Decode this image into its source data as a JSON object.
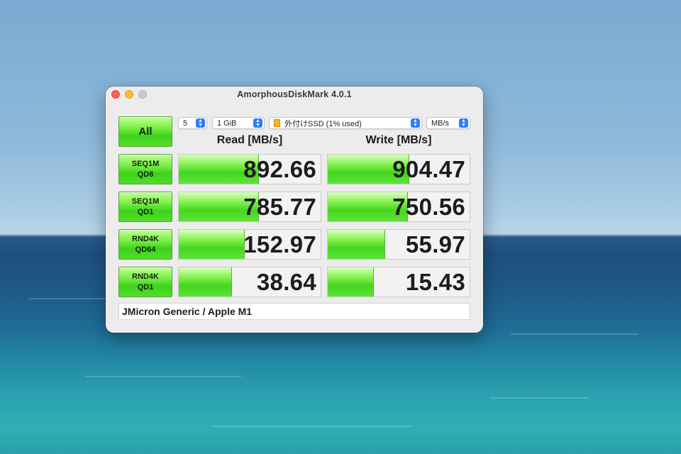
{
  "window": {
    "title": "AmorphousDiskMark 4.0.1"
  },
  "toolbar": {
    "all_label": "All",
    "count": "5",
    "size": "1 GiB",
    "drive": "外付けSSD (1% used)",
    "unit": "MB/s"
  },
  "headers": {
    "read": "Read [MB/s]",
    "write": "Write [MB/s]"
  },
  "tests": [
    {
      "line1": "SEQ1M",
      "line2": "QD8",
      "read": "892.66",
      "write": "904.47",
      "read_fill": 0.56,
      "write_fill": 0.57
    },
    {
      "line1": "SEQ1M",
      "line2": "QD1",
      "read": "785.77",
      "write": "750.56",
      "read_fill": 0.56,
      "write_fill": 0.56
    },
    {
      "line1": "RND4K",
      "line2": "QD64",
      "read": "152.97",
      "write": "55.97",
      "read_fill": 0.46,
      "write_fill": 0.4
    },
    {
      "line1": "RND4K",
      "line2": "QD1",
      "read": "38.64",
      "write": "15.43",
      "read_fill": 0.37,
      "write_fill": 0.32
    }
  ],
  "comment": "JMicron Generic / Apple M1",
  "colors": {
    "bar_green": "#45d61f",
    "accent_blue": "#2f7cf6"
  }
}
